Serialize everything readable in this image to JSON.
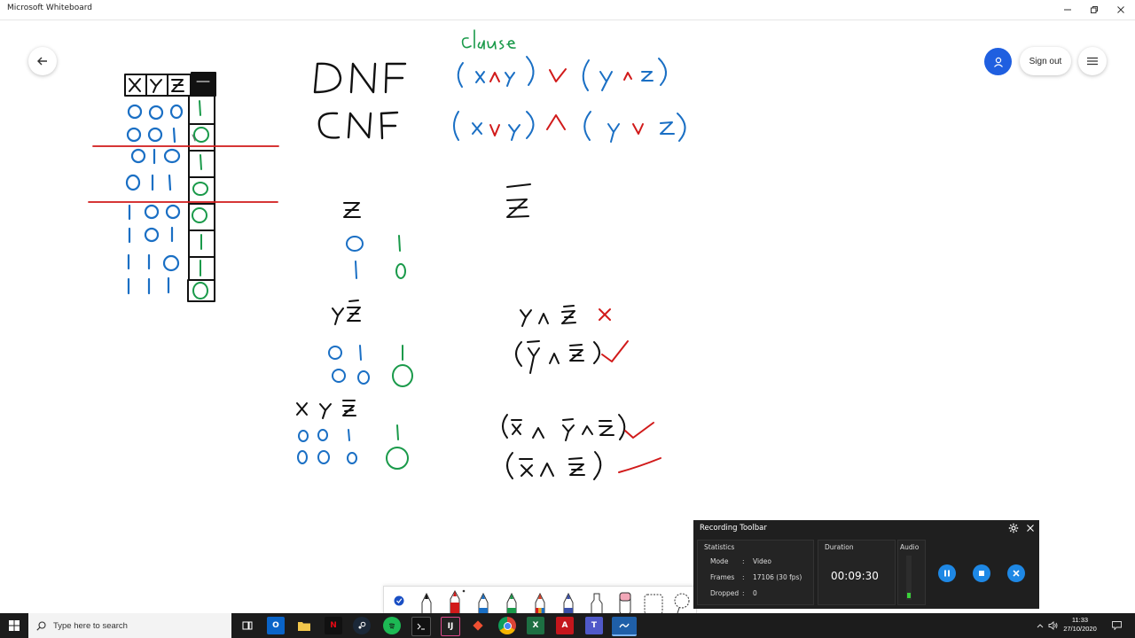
{
  "window": {
    "title": "Microsoft Whiteboard"
  },
  "header": {
    "sign_out_label": "Sign out"
  },
  "recording_toolbar": {
    "title": "Recording Toolbar",
    "statistics_label": "Statistics",
    "mode_label": "Mode",
    "mode_value": "Video",
    "frames_label": "Frames",
    "frames_value": "17106 (30 fps)",
    "dropped_label": "Dropped",
    "dropped_value": "0",
    "separator": ":",
    "duration_label": "Duration",
    "duration_value": "00:09:30",
    "audio_label": "Audio"
  },
  "taskbar": {
    "search_placeholder": "Type here to search",
    "time": "11:33",
    "date": "27/10/2020",
    "apps": [
      "task-view",
      "outlook",
      "file-explorer",
      "netflix",
      "steam",
      "spotify",
      "terminal",
      "intellij",
      "git",
      "chrome",
      "excel",
      "acrobat",
      "teams",
      "whiteboard"
    ]
  },
  "whiteboard_ink": {
    "truth_table_headers": [
      "x",
      "y",
      "z"
    ],
    "truth_table_rows": [
      [
        "0",
        "0",
        "0",
        "1"
      ],
      [
        "0",
        "0",
        "1",
        "0"
      ],
      [
        "0",
        "1",
        "0",
        "1"
      ],
      [
        "0",
        "1",
        "1",
        "0"
      ],
      [
        "1",
        "0",
        "0",
        "0"
      ],
      [
        "1",
        "0",
        "1",
        "1"
      ],
      [
        "1",
        "1",
        "0",
        "1"
      ],
      [
        "1",
        "1",
        "1",
        "0"
      ]
    ],
    "clause_label": "clause",
    "dnf_label": "DNF",
    "cnf_label": "CNF"
  },
  "colors": {
    "ink_black": "#111111",
    "ink_blue": "#1a6fc4",
    "ink_red": "#d11a1a",
    "ink_green": "#1a9a4a",
    "accent": "#1f5fe0"
  }
}
